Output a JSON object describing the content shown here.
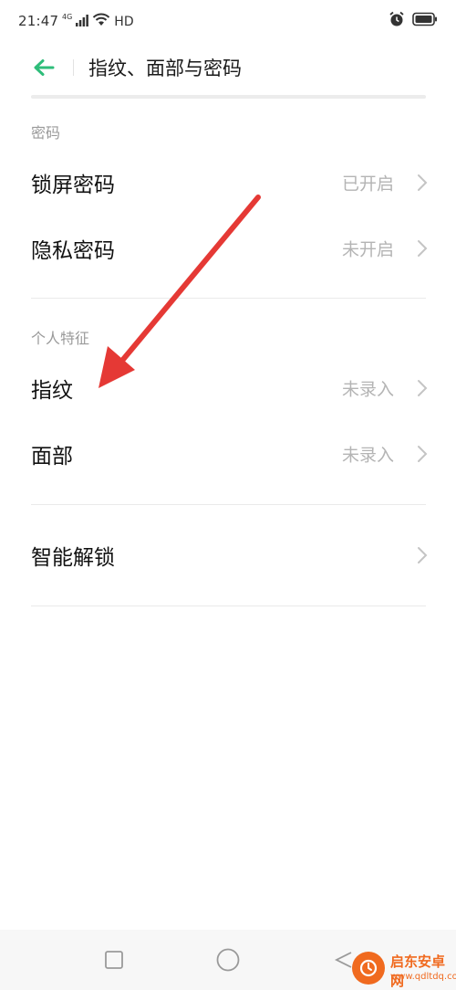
{
  "status_bar": {
    "time": "21:47",
    "network": "4G",
    "hd": "HD"
  },
  "header": {
    "title": "指纹、面部与密码"
  },
  "sections": [
    {
      "title": "密码",
      "items": [
        {
          "label": "锁屏密码",
          "value": "已开启"
        },
        {
          "label": "隐私密码",
          "value": "未开启"
        }
      ]
    },
    {
      "title": "个人特征",
      "items": [
        {
          "label": "指纹",
          "value": "未录入"
        },
        {
          "label": "面部",
          "value": "未录入"
        }
      ]
    },
    {
      "title": "",
      "items": [
        {
          "label": "智能解锁",
          "value": ""
        }
      ]
    }
  ],
  "annotation": {
    "arrow_color": "#e53935",
    "points_to": "指纹"
  },
  "watermark": {
    "brand": "启东安卓网",
    "url": "www.qdltdq.com"
  },
  "colors": {
    "accent": "#2ebd7a",
    "label": "#111111",
    "value": "#b4b4b4",
    "section_title": "#9a9a9a"
  }
}
